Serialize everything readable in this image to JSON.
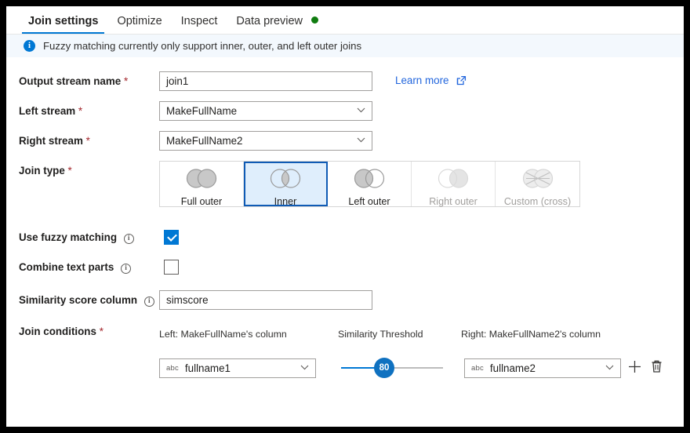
{
  "tabs": [
    {
      "label": "Join settings",
      "active": true,
      "dot": false
    },
    {
      "label": "Optimize",
      "active": false,
      "dot": false
    },
    {
      "label": "Inspect",
      "active": false,
      "dot": false
    },
    {
      "label": "Data preview",
      "active": false,
      "dot": true
    }
  ],
  "info_bar": {
    "icon": "info-icon",
    "message": "Fuzzy matching currently only support inner, outer, and left outer joins"
  },
  "fields": {
    "output_stream": {
      "label": "Output stream name",
      "required": "*",
      "value": "join1",
      "placeholder": "Output stream name"
    },
    "left_stream": {
      "label": "Left stream",
      "required": "*",
      "value": "MakeFullName"
    },
    "right_stream": {
      "label": "Right stream",
      "required": "*",
      "value": "MakeFullName2"
    },
    "join_type": {
      "label": "Join type",
      "required": "*",
      "selected": "Inner",
      "options": [
        {
          "label": "Full outer",
          "icon": "venn-full-outer-icon",
          "disabled": false
        },
        {
          "label": "Inner",
          "icon": "venn-inner-icon",
          "disabled": false
        },
        {
          "label": "Left outer",
          "icon": "venn-left-outer-icon",
          "disabled": false
        },
        {
          "label": "Right outer",
          "icon": "venn-right-outer-icon",
          "disabled": true
        },
        {
          "label": "Custom (cross)",
          "icon": "venn-cross-icon",
          "disabled": true
        }
      ]
    },
    "use_fuzzy_matching": {
      "label": "Use fuzzy matching",
      "info": "info-glyph",
      "checked": true
    },
    "combine_text_parts": {
      "label": "Combine text parts",
      "info": "info-glyph",
      "checked": false
    },
    "similarity_score_column": {
      "label": "Similarity score column",
      "info": "info-glyph",
      "value": "simscore",
      "placeholder": "Similarity score column"
    }
  },
  "learn_more": {
    "label": "Learn more",
    "icon": "external-link-icon"
  },
  "join_conditions": {
    "label": "Join conditions",
    "required": "*",
    "columns": [
      "Left: MakeFullName's column",
      "Similarity Threshold",
      "Right: MakeFullName2's column"
    ],
    "rows": [
      {
        "left_column": "fullname1",
        "left_type_icon": "abc",
        "threshold": "80",
        "right_column": "fullname2",
        "right_type_icon": "abc",
        "add_icon": "plus-icon",
        "delete_icon": "trash-icon"
      }
    ]
  },
  "colors": {
    "accent": "#0078d4",
    "accent_dark": "#0f5bb5",
    "link": "#2266dd",
    "status_green": "#107c10",
    "info_bg": "#f3f8fd",
    "required_red": "#a4262c",
    "selected_bg": "#dfeefc"
  }
}
